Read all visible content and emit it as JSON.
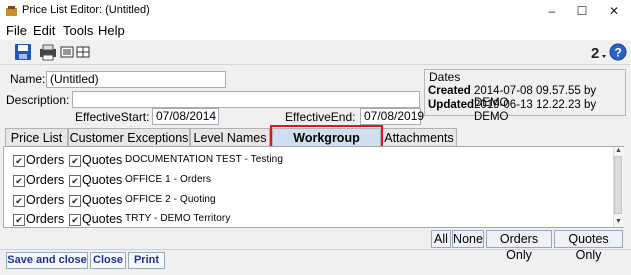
{
  "window": {
    "title": "Price List Editor: (Untitled)"
  },
  "menu": [
    "File",
    "Edit",
    "Tools",
    "Help"
  ],
  "form": {
    "name_label": "Name:",
    "name_value": "(Untitled)",
    "description_label": "Description:",
    "description_value": "",
    "effective_start_label": "EffectiveStart:",
    "effective_start_value": "07/08/2014",
    "effective_end_label": "EffectiveEnd:",
    "effective_end_value": "07/08/2019"
  },
  "dates": {
    "title": "Dates",
    "created_label": "Created",
    "created_value": "2014-07-08 09.57.55 by DEMO",
    "updated_label": "Updated",
    "updated_value": "2019-06-13 12.22.23 by DEMO"
  },
  "tabs": [
    "Price List",
    "Customer Exceptions",
    "Level Names",
    "Workgroup Access",
    "Attachments"
  ],
  "active_tab": "Workgroup Access",
  "highlight_color": "#e0141c",
  "workgroups": [
    {
      "orders": "Orders",
      "orders_checked": true,
      "quotes": "Quotes",
      "quotes_checked": true,
      "name": "DOCUMENTATION TEST - Testing"
    },
    {
      "orders": "Orders",
      "orders_checked": true,
      "quotes": "Quotes",
      "quotes_checked": true,
      "name": "OFFICE 1 - Orders"
    },
    {
      "orders": "Orders",
      "orders_checked": true,
      "quotes": "Quotes",
      "quotes_checked": true,
      "name": "OFFICE 2 - Quoting"
    },
    {
      "orders": "Orders",
      "orders_checked": true,
      "quotes": "Quotes",
      "quotes_checked": true,
      "name": "TRTY - DEMO Territory"
    }
  ],
  "select_buttons": [
    "All",
    "None",
    "Orders Only",
    "Quotes Only"
  ],
  "bottom_buttons": [
    "Save and close",
    "Close",
    "Print"
  ]
}
